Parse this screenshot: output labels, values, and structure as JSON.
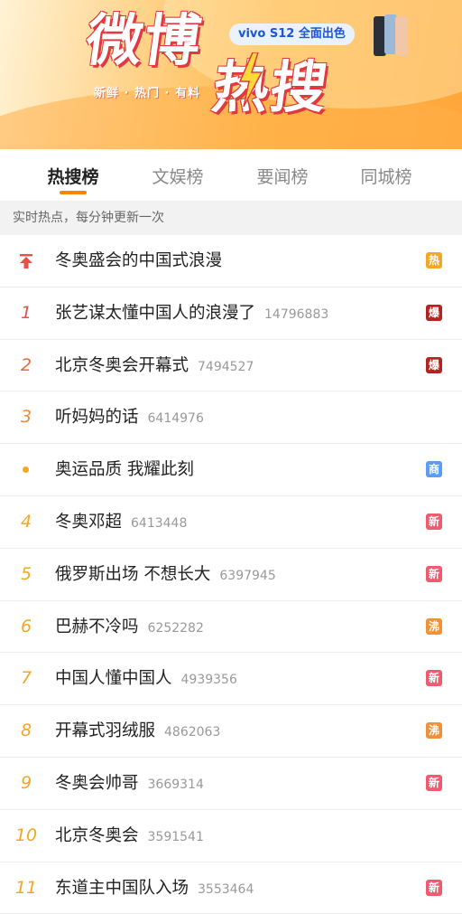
{
  "banner": {
    "title_line1": "微博",
    "title_line2": "热搜",
    "slogan": "新鲜 · 热门 · 有料",
    "ad_text": "vivo S12 全面出色"
  },
  "tabs": [
    {
      "label": "热搜榜",
      "active": true
    },
    {
      "label": "文娱榜",
      "active": false
    },
    {
      "label": "要闻榜",
      "active": false
    },
    {
      "label": "同城榜",
      "active": false
    }
  ],
  "notice": "实时热点，每分钟更新一次",
  "colors": {
    "accent": "#ff8200",
    "badge_hot": "#f5a623",
    "badge_boom": "#b3231f",
    "badge_ad": "#5b9df5",
    "badge_new": "#ef5a6e",
    "badge_boil": "#f0913a"
  },
  "items": [
    {
      "rank": "",
      "rank_type": "pin",
      "topic": "冬奥盛会的中国式浪漫",
      "count": "",
      "badge": "热",
      "badge_color": "#f5a623"
    },
    {
      "rank": "1",
      "rank_type": "num",
      "topic": "张艺谋太懂中国人的浪漫了",
      "count": "14796883",
      "badge": "爆",
      "badge_color": "#b3231f"
    },
    {
      "rank": "2",
      "rank_type": "num",
      "topic": "北京冬奥会开幕式",
      "count": "7494527",
      "badge": "爆",
      "badge_color": "#b3231f"
    },
    {
      "rank": "3",
      "rank_type": "num",
      "topic": "听妈妈的话",
      "count": "6414976",
      "badge": "",
      "badge_color": ""
    },
    {
      "rank": "",
      "rank_type": "dot",
      "topic": "奥运品质 我耀此刻",
      "count": "",
      "badge": "商",
      "badge_color": "#5b9df5"
    },
    {
      "rank": "4",
      "rank_type": "num",
      "topic": "冬奥邓超",
      "count": "6413448",
      "badge": "新",
      "badge_color": "#ef5a6e"
    },
    {
      "rank": "5",
      "rank_type": "num",
      "topic": "俄罗斯出场 不想长大",
      "count": "6397945",
      "badge": "新",
      "badge_color": "#ef5a6e"
    },
    {
      "rank": "6",
      "rank_type": "num",
      "topic": "巴赫不冷吗",
      "count": "6252282",
      "badge": "沸",
      "badge_color": "#f0913a"
    },
    {
      "rank": "7",
      "rank_type": "num",
      "topic": "中国人懂中国人",
      "count": "4939356",
      "badge": "新",
      "badge_color": "#ef5a6e"
    },
    {
      "rank": "8",
      "rank_type": "num",
      "topic": "开幕式羽绒服",
      "count": "4862063",
      "badge": "沸",
      "badge_color": "#f0913a"
    },
    {
      "rank": "9",
      "rank_type": "num",
      "topic": "冬奥会帅哥",
      "count": "3669314",
      "badge": "新",
      "badge_color": "#ef5a6e"
    },
    {
      "rank": "10",
      "rank_type": "num",
      "topic": "北京冬奥会",
      "count": "3591541",
      "badge": "",
      "badge_color": ""
    },
    {
      "rank": "11",
      "rank_type": "num",
      "topic": "东道主中国队入场",
      "count": "3553464",
      "badge": "新",
      "badge_color": "#ef5a6e"
    }
  ]
}
